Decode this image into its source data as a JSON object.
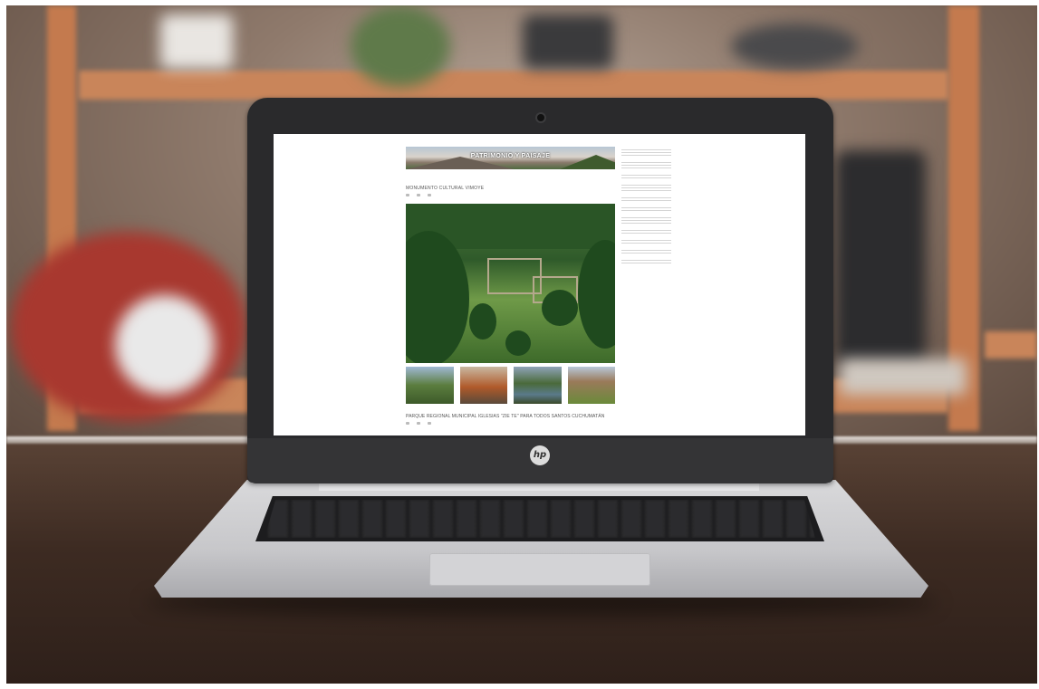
{
  "screen": {
    "banner_title": "PATRIMONIO Y PAISAJE",
    "breadcrumb": "",
    "posts": [
      {
        "title": "MONUMENTO CULTURAL VIMOYE",
        "meta": [
          "",
          "",
          ""
        ]
      },
      {
        "title": "PARQUE REGIONAL MUNICIPAL IGLESIAS \"ZIE TE\" PARA TODOS SANTOS CUCHUMATÁN",
        "meta": [
          "",
          "",
          ""
        ]
      }
    ],
    "sidebar": {
      "heading": "",
      "links": [
        "",
        "",
        "",
        "",
        "",
        "",
        "",
        "",
        "",
        "",
        ""
      ]
    }
  },
  "device": {
    "logo": "hp"
  },
  "colors": {
    "sidebar_heading": "#4bb3c9",
    "shelf": "#c47a4e",
    "desk": "#3d2b22"
  }
}
